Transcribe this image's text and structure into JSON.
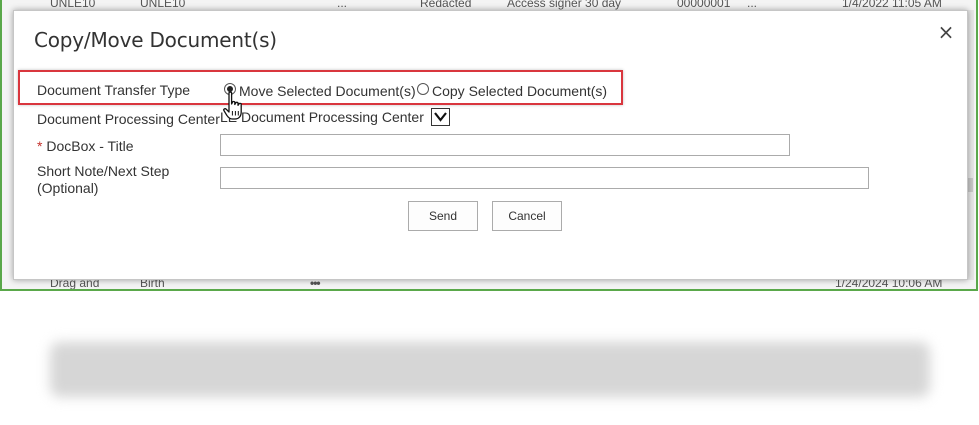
{
  "background": {
    "top_row": [
      "UNLE10",
      "UNLE10",
      "...",
      "Redacted",
      "Access signer 30 day",
      "00000001",
      "...",
      "1/4/2022 11:05 AM"
    ],
    "bottom_row": {
      "name": "Drag and",
      "type": "Birth",
      "more": "•••",
      "modified": "1/24/2024 10:06 AM"
    }
  },
  "dialog": {
    "title": "Copy/Move Document(s)",
    "close": "×",
    "fields": {
      "transfer_type": {
        "label": "Document Transfer Type",
        "options": [
          "Move Selected Document(s)",
          "Copy Selected Document(s)"
        ],
        "selected": "Move Selected Document(s)"
      },
      "processing_center": {
        "label": "Document Processing Center",
        "value": "LE Document Processing Center"
      },
      "docbox_title": {
        "required_marker": "*",
        "label": "DocBox - Title",
        "value": ""
      },
      "short_note": {
        "label_line1": "Short Note/Next Step",
        "label_line2": "(Optional)",
        "value": ""
      }
    },
    "buttons": {
      "send": "Send",
      "cancel": "Cancel"
    }
  },
  "colors": {
    "highlight": "#d9363e",
    "frame_border": "#5aa84a",
    "required": "#c4302b"
  },
  "icons": [
    "close-icon",
    "hand-pointer-cursor-icon",
    "chevron-down-icon"
  ]
}
